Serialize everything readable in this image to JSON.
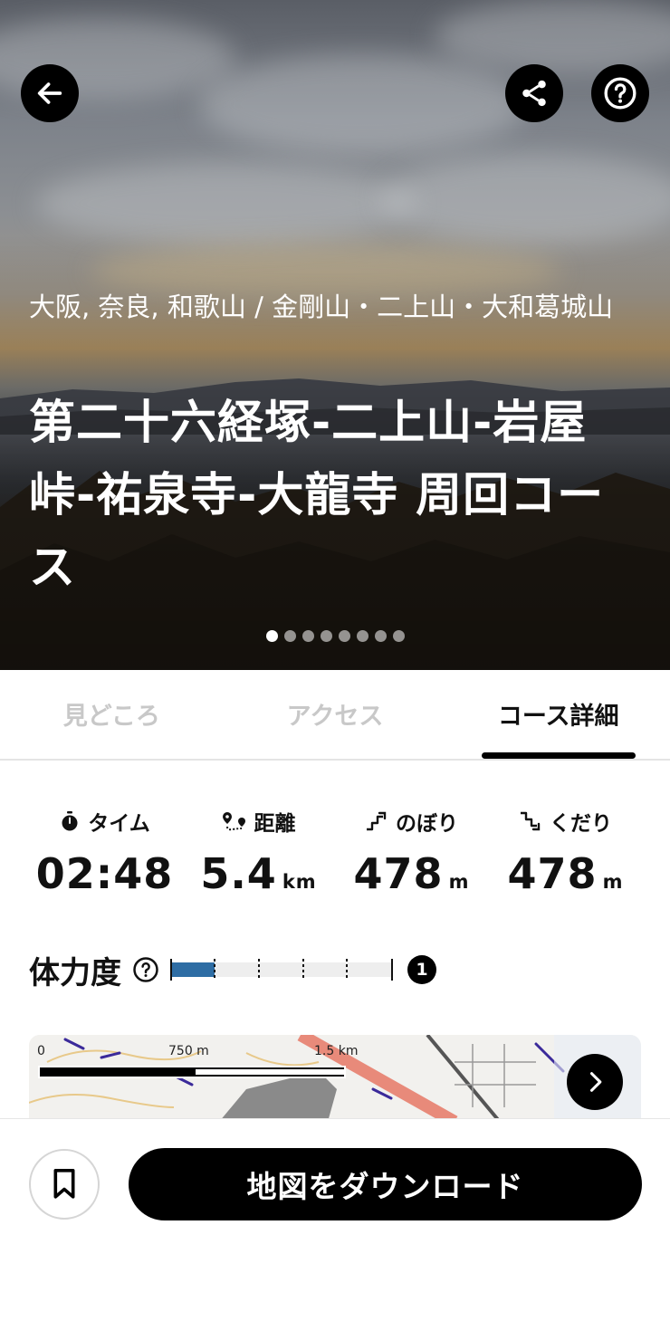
{
  "hero": {
    "area": "大阪, 奈良, 和歌山 / 金剛山・二上山・大和葛城山",
    "title": "第二十六経塚-二上山-岩屋峠-祐泉寺-大龍寺 周回コース",
    "photo_count": 8,
    "active_photo_index": 0
  },
  "tabs": [
    {
      "label": "見どころ",
      "active": false
    },
    {
      "label": "アクセス",
      "active": false
    },
    {
      "label": "コース詳細",
      "active": true
    }
  ],
  "stats": {
    "time": {
      "icon": "stopwatch-icon",
      "label": "タイム",
      "value": "02:48",
      "unit": ""
    },
    "distance": {
      "icon": "route-icon",
      "label": "距離",
      "value": "5.4",
      "unit": "km"
    },
    "ascent": {
      "icon": "uphill-icon",
      "label": "のぼり",
      "value": "478",
      "unit": "m"
    },
    "descent": {
      "icon": "downhill-icon",
      "label": "くだり",
      "value": "478",
      "unit": "m"
    }
  },
  "stamina": {
    "label": "体力度",
    "level": "1",
    "max_level": 5,
    "fill_fraction": 0.2,
    "fill_color": "#2e6da4"
  },
  "map": {
    "scale_zero": "0",
    "scale_mid": "750 m",
    "scale_max": "1.5 km"
  },
  "actions": {
    "download_label": "地図をダウンロード"
  },
  "colors": {
    "primary": "#000000",
    "meter_fill": "#2e6da4",
    "tab_inactive": "#c8c8c8"
  }
}
